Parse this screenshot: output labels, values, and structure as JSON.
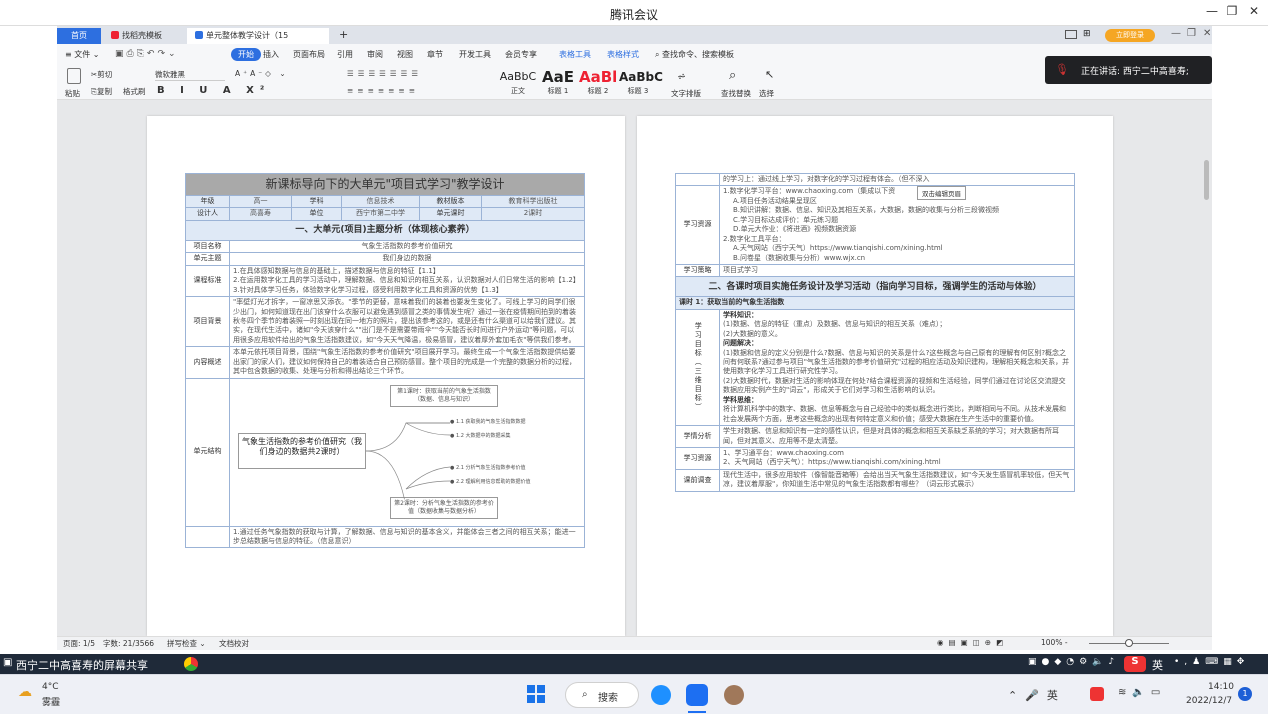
{
  "meeting": {
    "title": "腾讯会议",
    "min": "—",
    "max": "❐",
    "close": "✕"
  },
  "wps": {
    "tabs": [
      {
        "label": "首页"
      },
      {
        "label": "找稻壳模板"
      },
      {
        "label": "单元整体教学设计（15版）.docx"
      },
      {
        "label": "+"
      }
    ],
    "login_btn": "立即登录",
    "menu": [
      "≡ 文件 ⌄",
      "开始",
      "插入",
      "页面布局",
      "引用",
      "审阅",
      "视图",
      "章节",
      "开发工具",
      "会员专享",
      "表格工具",
      "表格样式",
      "查找命令、搜索模板"
    ],
    "ribbon": {
      "paste": "粘贴",
      "cut": "剪切",
      "copy": "复制",
      "format_painter": "格式刷",
      "font": "微软雅黑",
      "size": "",
      "styles": [
        {
          "preview": "AaBbC",
          "label": "正文"
        },
        {
          "preview": "AaE",
          "label": "标题 1"
        },
        {
          "preview": "AaBl",
          "label": "标题 2"
        },
        {
          "preview": "AaBbC",
          "label": "标题 3"
        }
      ],
      "text_tools": "文字排版",
      "find_replace": "查找替换",
      "select": "选择"
    },
    "status": {
      "page": "页面: 1/5",
      "words": "字数: 21/3566",
      "spell": "拼写检查 ⌄",
      "proof": "文档校对",
      "zoom": "100% -"
    }
  },
  "speaker": {
    "text": "正在讲话: 西宁二中高喜寿;"
  },
  "doc1": {
    "title": "新课标导向下的大单元\"项目式学习\"教学设计",
    "r1": [
      "年级",
      "高一",
      "学科",
      "信息技术",
      "教材版本",
      "教育科学出版社"
    ],
    "r2": [
      "设计人",
      "高喜寿",
      "单位",
      "西宁市第二中学",
      "单元课时",
      "2课时"
    ],
    "sec1": "一、大单元(项目)主题分析（体现核心素养）",
    "proj_name_lbl": "项目名称",
    "proj_name": "气象生活指数的参考价值研究",
    "unit_theme_lbl": "单元主题",
    "unit_theme": "我们身边的数据",
    "std_lbl": "课程标准",
    "std": [
      "1.在具体感知数据与信息的基础上，描述数据与信息的特征【1.1】",
      "2.在运用数字化工具的学习活动中，理解数据、信息和知识的相互关系，认识数据对人们日常生活的影响【1.2】",
      "3.针对具体学习任务，体验数字化学习过程，感受利用数字化工具和资源的优势【1.3】"
    ],
    "bg_lbl": "项目背景",
    "bg": "\"率壁灯光才拆字，一窗凉思又添衣。\"季节的更替，意味着我们的装着也要发生变化了。可线上学习的同学们很少出门，如何知道现在出门该穿什么衣服可以避免遇到感冒之类的事情发生呢？通过一张在疫情期间拍到的着装秋冬四个季节的着装照一时刻出现在同一地方的照片，提出该参考这的，或是还有什么渠道可以给我们建议。其实，在现代生活中，诸如\"今天该穿什么\"\"出门是不是需要带雨伞\"\"今天能否长时间进行户外运动\"等问题，可以用很多应用软件给出的气象生活指数建议，如\"今天天气降温，极易感冒，建议着厚外套加毛衣\"等供我们参考。",
    "overview_lbl": "内容概述",
    "overview": "本单元依托项目背景，围绕\"气象生活指数的参考价值研究\"项目展开学习。最终生成一个气象生活指数提供给要出家门的家人们，建议如何保持自己的着装适合自己预防感冒。整个项目的完成是一个完整的数据分析的过程，其中包含数据的收集、处理与分析和得出结论三个环节。",
    "struct_lbl": "单元结构",
    "mind_center": "气象生活指数的参考价值研究（我们身边的数据共2课时）",
    "mind_top": "第1课时：获取当前的气象生活指数（数据、信息与知识）",
    "mind_bottom": "第2课时：分析气象生活指数的参考价值（数据收集与数据分析）",
    "mind_items": [
      "1.1 获取我的气象生活指数数据",
      "1.2 大数据中的数据采集",
      "2.1 分析气象生活指数参考价值",
      "2.2 理解利用信息帮助的数据价值"
    ],
    "last_row": "1.通过任务气象指数的获取与计算，了解数据、信息与知识的基本含义，并能体会三者之间的相互关系；能进一步总结数据与信息的特征。（信息意识）"
  },
  "doc2": {
    "top_text": "的学习上：通过线上学习，对数字化的学习过程有体会。（但不深入",
    "tooltip": "双击编辑页眉",
    "res_lbl": "学习资源",
    "res": [
      "1.数字化学习平台：www.chaoxing.com（集成以下资",
      "A.项目任务活动结果呈现区",
      "B.知识讲解：数据、信息、知识及其相互关系，大数据，数据的收集与分析三段微视频",
      "C.学习目标达成评价：单元练习题",
      "D.单元大作业：《将进酒》视频数据资源",
      "2.数字化工具平台：",
      "A.天气网站（西宁天气）https://www.tianqishi.com/xining.html",
      "B.问卷星（数据收集与分析）www.wjx.cn"
    ],
    "strat_lbl": "学习策略",
    "strat": "项目式学习",
    "sec2": "二、各课时项目实施任务设计及学习活动（指向学习目标，强调学生的活动与体验）",
    "lesson1": "课时 1：获取当前的气象生活指数",
    "goal_lbl": "学习目标（三维目标）",
    "goals": [
      "学科知识：",
      "(1)数据、信息的特征（重点）及数据、信息与知识的相互关系（难点）；",
      "(2)大数据的意义。",
      "问题解决：",
      "(1)数据和信息的定义分别是什么?数据、信息与知识的关系是什么?这些概念与自己原有的理解有何区别?概念之间有何联系?通过参与项目\"气象生活指数的参考价值研究\"过程的相应活动及知识建构，理解相关概念和关系，并使用数字化学习工具进行研究性学习。",
      "(2)大数据时代，数据对生活的影响体现在何处?结合课程资源的视频和生活经验，同学们通过在讨论区交流提交数据应用实例产生的\"词云\"，形成关于它们对学习和生活影响的认识。",
      "学科思维：",
      "将计算机科学中的数字、数据、信息等概念与自己经验中的类似概念进行类比，判断相同与不同。从技术发展和社会发展两个方面，思考这些概念的出现有何特定意义和价值；感受大数据在生产生活中的重要价值。"
    ],
    "analysis_lbl": "学情分析",
    "analysis": "学生对数据、信息和知识有一定的感性认识，但是对具体的概念和相互关系缺乏系统的学习；对大数据有所耳闻，但对其意义、应用等不是太清楚。",
    "lres_lbl": "学习资源",
    "lres": [
      "1、学习通平台：www.chaoxing.com",
      "2、天气网站（西宁天气）：https://www.tianqishi.com/xining.html"
    ],
    "survey_lbl": "课前调查",
    "survey": "现代生活中，很多应用软件（像智能音箱等）会给出当天气象生活指数建议，如\"今天发生感冒机率较低，但天气凉，建议着厚服\"，你知道生活中常见的气象生活指数都有哪些？（词云形式展示）"
  },
  "share": {
    "label": "西宁二中高喜寿的屏幕共享"
  },
  "taskbar": {
    "weather_temp": "4°C",
    "weather_desc": "雾霾",
    "search": "搜索",
    "time": "14:10",
    "date": "2022/12/7",
    "ime": "英",
    "notif": "1"
  }
}
